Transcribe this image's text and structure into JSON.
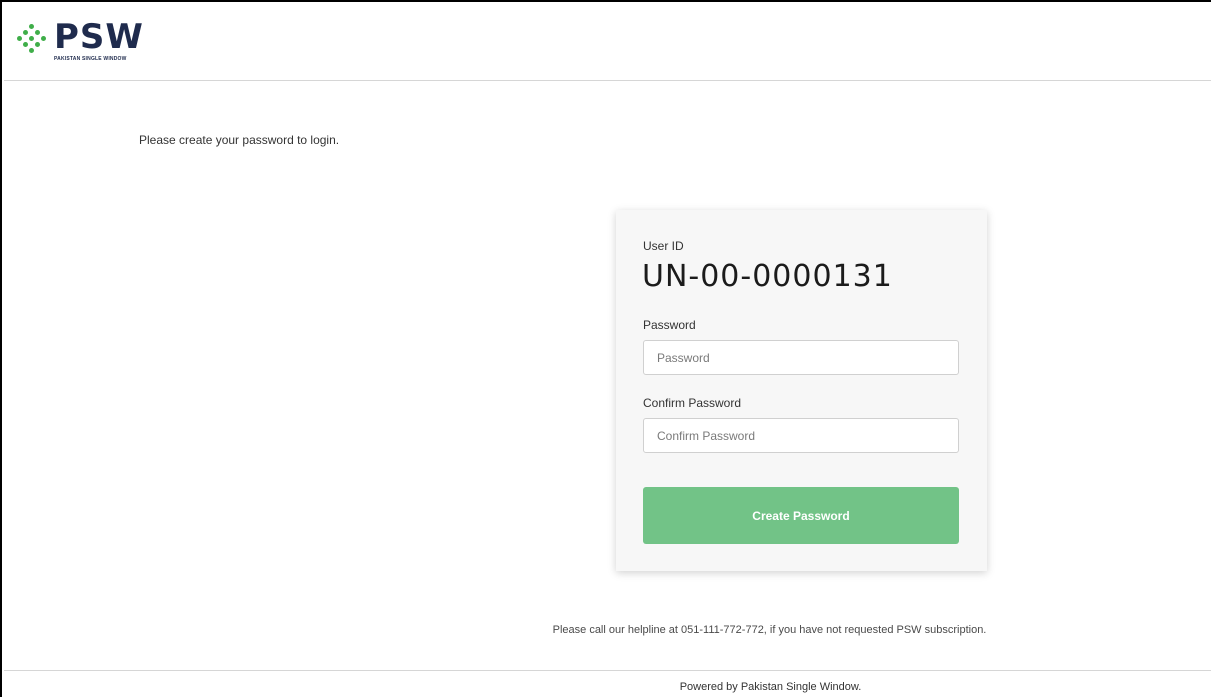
{
  "brand": {
    "name": "PSW",
    "subtitle": "PAKISTAN SINGLE WINDOW",
    "logo_icon": "psw-dots-logo-icon",
    "accent_color": "#3fae49",
    "text_color": "#1f2b4d"
  },
  "intro_text": "Please create your password to login.",
  "form": {
    "user_id_label": "User ID",
    "user_id_value": "UN-00-0000131",
    "password_label": "Password",
    "password_placeholder": "Password",
    "confirm_label": "Confirm Password",
    "confirm_placeholder": "Confirm Password",
    "submit_label": "Create Password",
    "submit_color": "#72c387"
  },
  "helpline_text": "Please call our helpline at 051-111-772-772, if you have not requested PSW subscription.",
  "footer_text": "Powered by Pakistan Single Window."
}
